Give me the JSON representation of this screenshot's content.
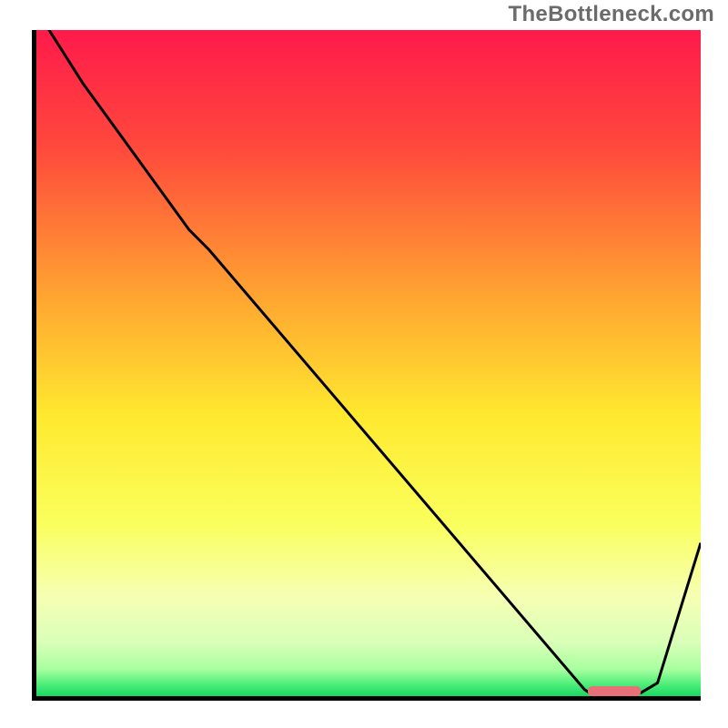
{
  "attribution": "TheBottleneck.com",
  "chart_data": {
    "type": "line",
    "title": "",
    "xlabel": "",
    "ylabel": "",
    "xlim": [
      0,
      100
    ],
    "ylim": [
      0,
      100
    ],
    "gradient_stops": [
      {
        "offset": 0,
        "color": "#ff1a4b"
      },
      {
        "offset": 18,
        "color": "#ff4a3c"
      },
      {
        "offset": 40,
        "color": "#ffa531"
      },
      {
        "offset": 58,
        "color": "#ffe92f"
      },
      {
        "offset": 74,
        "color": "#faff5c"
      },
      {
        "offset": 85,
        "color": "#f6ffb3"
      },
      {
        "offset": 92,
        "color": "#d9ffb8"
      },
      {
        "offset": 96,
        "color": "#a7ff9e"
      },
      {
        "offset": 98,
        "color": "#56f07d"
      },
      {
        "offset": 100,
        "color": "#18d862"
      }
    ],
    "series": [
      {
        "name": "bottleneck-curve",
        "x": [
          0,
          7,
          23,
          26,
          82.5,
          84,
          87,
          91,
          93.5,
          100
        ],
        "y": [
          103,
          92,
          70,
          67,
          1,
          0,
          0,
          0.5,
          2,
          23
        ]
      }
    ],
    "marker": {
      "name": "optimal-range",
      "x_start": 83,
      "x_end": 91,
      "y": 0.8,
      "color": "#e97079"
    }
  }
}
